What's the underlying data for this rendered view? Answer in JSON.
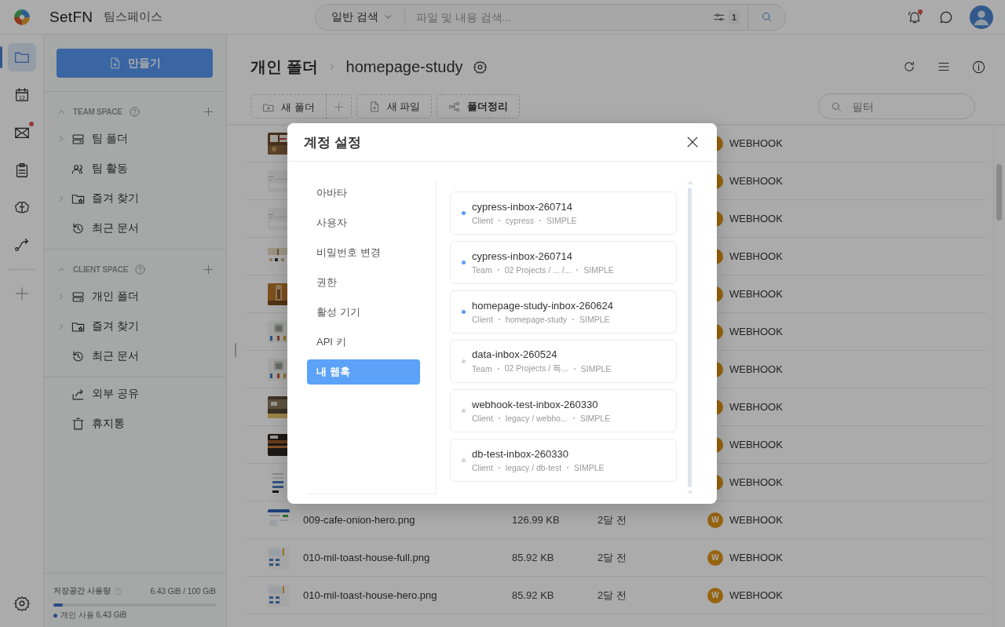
{
  "topbar": {
    "brand": "SetFN",
    "workspace": "팀스페이스",
    "search": {
      "mode": "일반 검색",
      "placeholder": "파일 및 내용 검색...",
      "filter_count": "1"
    },
    "notifications": {
      "unread": true
    }
  },
  "rail": {
    "items": [
      {
        "kind": "folder",
        "selected": true,
        "badge": false
      },
      {
        "kind": "calendar",
        "label": "12",
        "selected": false,
        "badge": false
      },
      {
        "kind": "mail",
        "selected": false,
        "badge": true
      },
      {
        "kind": "clipboard",
        "selected": false,
        "badge": false
      },
      {
        "kind": "brain",
        "selected": false,
        "badge": false
      },
      {
        "kind": "route",
        "selected": false,
        "badge": false
      }
    ]
  },
  "sidebar": {
    "create_button": "만들기",
    "sections": [
      {
        "title": "TEAM SPACE",
        "expanded": true,
        "items": [
          {
            "kind": "server",
            "label": "팀 폴더",
            "expandable": true
          },
          {
            "kind": "people",
            "label": "팀 활동",
            "expandable": false
          },
          {
            "kind": "folder-star",
            "label": "즐겨 찾기",
            "expandable": true
          },
          {
            "kind": "history",
            "label": "최근 문서",
            "expandable": false
          }
        ]
      },
      {
        "title": "CLIENT SPACE",
        "expanded": true,
        "items": [
          {
            "kind": "server",
            "label": "개인 폴더",
            "expandable": true
          },
          {
            "kind": "folder-star",
            "label": "즐겨 찾기",
            "expandable": true
          },
          {
            "kind": "history",
            "label": "최근 문서",
            "expandable": false
          }
        ]
      }
    ],
    "extra_items": [
      {
        "kind": "share",
        "label": "외부 공유"
      },
      {
        "kind": "trash",
        "label": "휴지통"
      }
    ],
    "storage": {
      "label": "저장공간 사용량",
      "value": "6.43 GiB / 100 GiB",
      "level": 0.06,
      "personal": "개인 사용 6.43 GiB"
    }
  },
  "breadcrumb": [
    "개인 폴더",
    "homepage-study"
  ],
  "toolbar": {
    "new_folder": "새 폴더",
    "new_file": "새 파일",
    "organize": "폴더정리",
    "filter_placeholder": "필터"
  },
  "table": {
    "rows": [
      {
        "owner": "WEBHOOK"
      },
      {
        "owner": "WEBHOOK"
      },
      {
        "owner": "WEBHOOK"
      },
      {
        "owner": "WEBHOOK"
      },
      {
        "owner": "WEBHOOK"
      },
      {
        "owner": "WEBHOOK"
      },
      {
        "owner": "WEBHOOK"
      },
      {
        "owner": "WEBHOOK"
      },
      {
        "owner": "WEBHOOK"
      },
      {
        "owner": "WEBHOOK"
      },
      {
        "name": "009-cafe-onion-hero.png",
        "size": "126.99 KB",
        "modified": "2달 전",
        "avatar": "W",
        "owner": "WEBHOOK"
      },
      {
        "name": "010-mil-toast-house-full.png",
        "size": "85.92 KB",
        "modified": "2달 전",
        "avatar": "W",
        "owner": "WEBHOOK"
      },
      {
        "name": "010-mil-toast-house-hero.png",
        "size": "85.92 KB",
        "modified": "2달 전",
        "avatar": "W",
        "owner": "WEBHOOK"
      }
    ]
  },
  "modal": {
    "title": "계정 설정",
    "nav": [
      {
        "label": "아바타",
        "selected": false
      },
      {
        "label": "사용자",
        "selected": false
      },
      {
        "label": "비밀번호 변경",
        "selected": false
      },
      {
        "label": "권한",
        "selected": false
      },
      {
        "label": "활성 기기",
        "selected": false
      },
      {
        "label": "API 키",
        "selected": false
      },
      {
        "label": "내 웹훅",
        "selected": true
      }
    ],
    "webhooks": [
      {
        "name": "cypress-inbox-260714",
        "scope": "Client",
        "path": "cypress",
        "type": "SIMPLE",
        "active": true
      },
      {
        "name": "cypress-inbox-260714",
        "scope": "Team",
        "path": "02 Projects / ... /...",
        "type": "SIMPLE",
        "active": true
      },
      {
        "name": "homepage-study-inbox-260624",
        "scope": "Client",
        "path": "homepage-study",
        "type": "SIMPLE",
        "active": true
      },
      {
        "name": "data-inbox-260524",
        "scope": "Team",
        "path": "02 Projects / 특...",
        "type": "SIMPLE",
        "active": false
      },
      {
        "name": "webhook-test-inbox-260330",
        "scope": "Client",
        "path": "legacy / webho...",
        "type": "SIMPLE",
        "active": false
      },
      {
        "name": "db-test-inbox-260330",
        "scope": "Client",
        "path": "legacy / db-test",
        "type": "SIMPLE",
        "active": false
      }
    ]
  }
}
